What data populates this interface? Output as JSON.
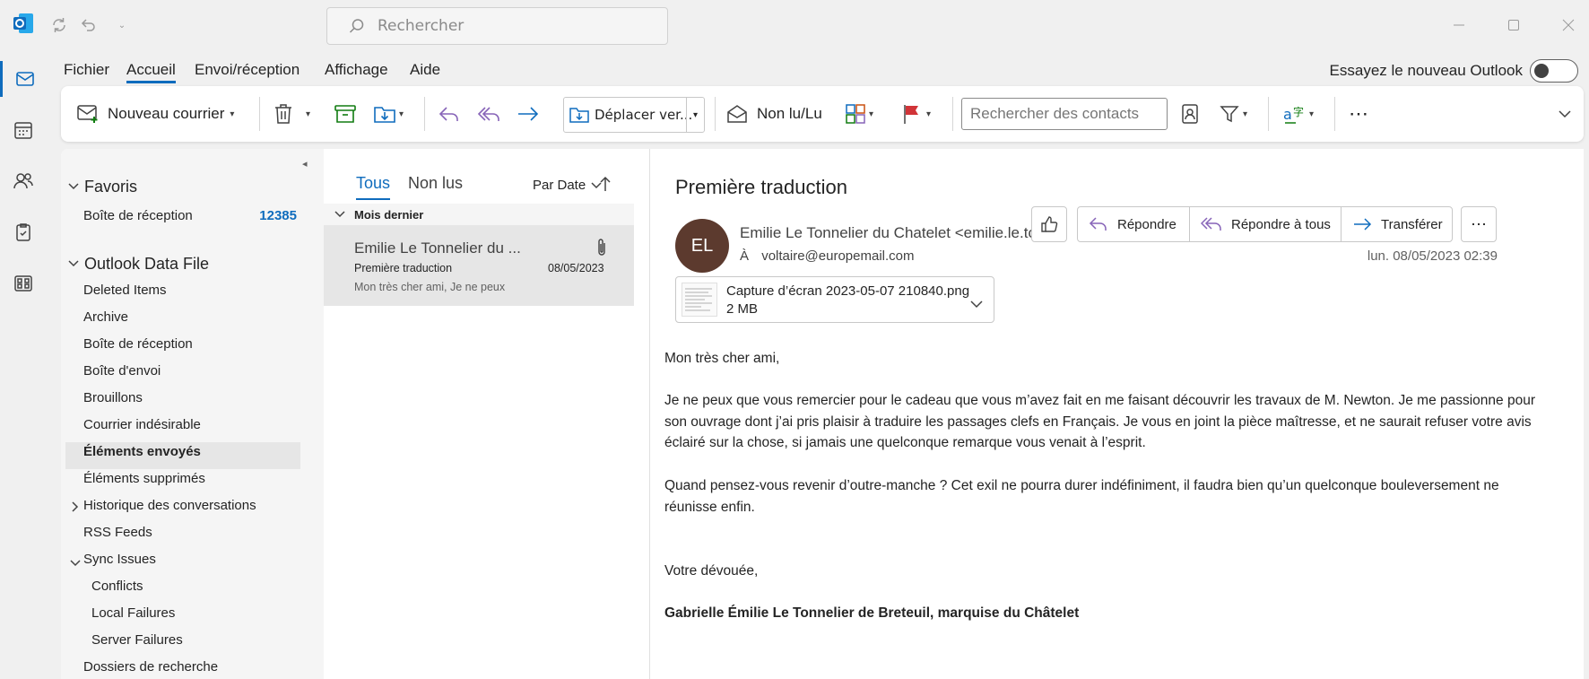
{
  "titlebar": {
    "search_placeholder": "Rechercher"
  },
  "menu": {
    "items": [
      "Fichier",
      "Accueil",
      "Envoi/réception",
      "Affichage",
      "Aide"
    ],
    "active": "Accueil",
    "try_new": "Essayez le nouveau Outlook"
  },
  "ribbon": {
    "new_mail": "Nouveau courrier",
    "move": "Déplacer ver...",
    "read_unread": "Non lu/Lu",
    "contact_search_placeholder": "Rechercher des contacts"
  },
  "folders": {
    "favorites_label": "Favoris",
    "favorites": [
      {
        "label": "Boîte de réception",
        "count": "12385"
      }
    ],
    "data_file_label": "Outlook Data File",
    "items": [
      "Deleted Items",
      "Archive",
      "Boîte de réception",
      "Boîte d'envoi",
      "Brouillons",
      "Courrier indésirable",
      "Éléments envoyés",
      "Éléments supprimés",
      "Historique des conversations",
      "RSS Feeds",
      "Sync Issues",
      "Conflicts",
      "Local Failures",
      "Server Failures",
      "Dossiers de recherche"
    ],
    "selected": "Éléments envoyés"
  },
  "message_list": {
    "tab_all": "Tous",
    "tab_unread": "Non lus",
    "sort_label": "Par Date",
    "group_label": "Mois dernier",
    "messages": [
      {
        "sender": "Emilie Le Tonnelier du ...",
        "subject": "Première traduction",
        "date": "08/05/2023",
        "preview": "Mon très cher ami,  Je ne peux"
      }
    ]
  },
  "reading": {
    "subject": "Première traduction",
    "avatar_initials": "EL",
    "avatar_color": "#5c3a2e",
    "from": "Emilie Le Tonnelier du Chatelet <emilie.le.to",
    "to_label": "À",
    "to": "voltaire@europemail.com",
    "date": "lun. 08/05/2023 02:39",
    "reply": "Répondre",
    "reply_all": "Répondre à tous",
    "forward": "Transférer",
    "attachment_name": "Capture d’écran 2023-05-07 210840.png",
    "attachment_size": "2 MB",
    "body": {
      "greeting": "Mon très cher ami,",
      "p1": "Je ne peux que vous remercier pour le cadeau que vous m’avez fait en me faisant découvrir les travaux de M. Newton. Je me passionne pour son ouvrage dont j’ai pris plaisir à traduire les passages clefs en Français. Je vous en joint la pièce maîtresse, et ne saurait refuser votre avis éclairé sur la chose, si jamais une quelconque remarque vous venait à l’esprit.",
      "p2": "Quand pensez-vous revenir d’outre-manche ? Cet exil ne pourra durer indéfiniment, il faudra bien qu’un quelconque bouleversement ne réunisse enfin.",
      "closing": "Votre dévouée,",
      "signature": "Gabrielle Émilie Le Tonnelier de Breteuil, marquise du Châtelet"
    }
  },
  "colors": {
    "accent": "#0f6cbd",
    "reply_purple": "#8764b8",
    "forward_blue": "#0f6cbd"
  }
}
